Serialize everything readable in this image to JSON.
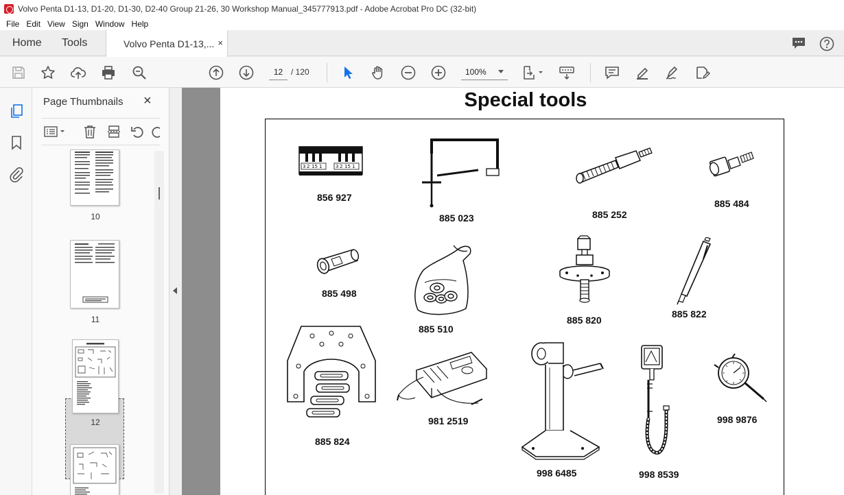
{
  "window": {
    "title": "Volvo Penta D1-13, D1-20, D1-30, D2-40 Group 21-26, 30 Workshop Manual_345777913.pdf - Adobe Acrobat Pro DC (32-bit)"
  },
  "menu": [
    "File",
    "Edit",
    "View",
    "Sign",
    "Window",
    "Help"
  ],
  "tabs": {
    "home": "Home",
    "tools": "Tools",
    "document": "Volvo Penta D1-13,...",
    "close": "×"
  },
  "toolbar": {
    "current_page": "12",
    "page_total": "/ 120",
    "zoom": "100%"
  },
  "thumbnails": {
    "title": "Page Thumbnails",
    "close": "×",
    "pages": [
      {
        "label": "10"
      },
      {
        "label": "11"
      },
      {
        "label": "12",
        "selected": true
      },
      {
        "label": ""
      }
    ]
  },
  "document": {
    "heading": "Special tools",
    "tools": [
      {
        "number": "856 927"
      },
      {
        "number": "885 023"
      },
      {
        "number": "885 252"
      },
      {
        "number": "885 484"
      },
      {
        "number": "885 498"
      },
      {
        "number": "885 510"
      },
      {
        "number": "885 820"
      },
      {
        "number": "885 822"
      },
      {
        "number": "885 824"
      },
      {
        "number": "981 2519"
      },
      {
        "number": "998 6485"
      },
      {
        "number": "998 8539"
      },
      {
        "number": "998 9876"
      }
    ]
  },
  "colors": {
    "accent": "#1473e6",
    "pdf_red": "#d5202a",
    "viewer_bg": "#8d8d8d"
  }
}
